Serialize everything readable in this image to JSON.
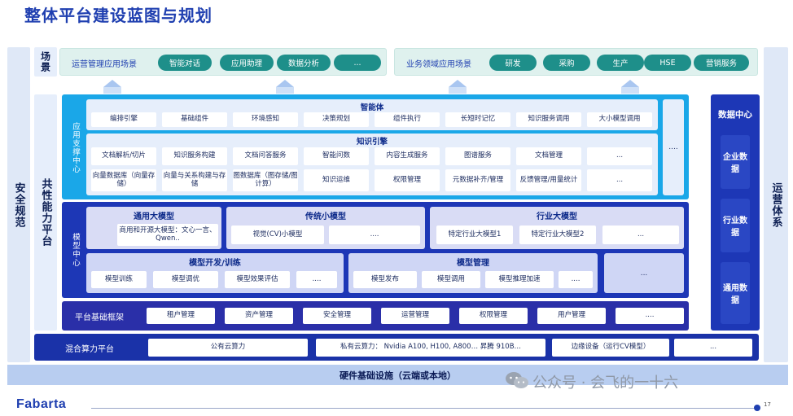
{
  "page_title": "整体平台建设蓝图与规划",
  "left_rail": "安全规范",
  "right_rail": "运营体系",
  "scenario": {
    "label": "场景",
    "ops_label": "运营管理应用场景",
    "ops_items": [
      "智能对话",
      "应用助理",
      "数据分析",
      "..."
    ],
    "biz_label": "业务领域应用场景",
    "biz_items": [
      "研发",
      "采购",
      "生产",
      "HSE",
      "营销服务"
    ]
  },
  "shared_platform_label": "共性能力平台",
  "app_center": {
    "label": "应用支撑中心",
    "agent": {
      "title": "智能体",
      "items": [
        "编排引擎",
        "基础组件",
        "环境感知",
        "决策规划",
        "组件执行",
        "长短时记忆",
        "知识服务调用",
        "大小模型调用"
      ]
    },
    "knowledge": {
      "title": "知识引擎",
      "row1": [
        "文档解析/切片",
        "知识服务构建",
        "文档问答服务",
        "智能问数",
        "内容生成服务",
        "图谱服务",
        "文档管理",
        "..."
      ],
      "row2": [
        "向量数据库（向量存储）",
        "向量与关系构建与存储",
        "图数据库（图存储/图计算）",
        "知识运维",
        "权限管理",
        "元数据补齐/管理",
        "反馈管理/用量统计",
        "..."
      ]
    },
    "more": "...."
  },
  "model_center": {
    "label": "模型中心",
    "general": {
      "title": "通用大模型",
      "items": [
        "商用和开源大模型：文心一言、Qwen.."
      ]
    },
    "traditional": {
      "title": "传统小模型",
      "items": [
        "视觉(CV)小模型",
        "...."
      ]
    },
    "industry": {
      "title": "行业大模型",
      "items": [
        "特定行业大模型1",
        "特定行业大模型2",
        "..."
      ]
    },
    "dev": {
      "title": "模型开发/训练",
      "items": [
        "模型训练",
        "模型调优",
        "模型效果评估",
        "...."
      ]
    },
    "mgmt": {
      "title": "模型管理",
      "items": [
        "模型发布",
        "模型调用",
        "模型推理加速",
        "...."
      ]
    },
    "more": "..."
  },
  "platform_base": {
    "label": "平台基础框架",
    "items": [
      "租户管理",
      "资产管理",
      "安全管理",
      "运营管理",
      "权限管理",
      "用户管理",
      "...."
    ]
  },
  "data_center": {
    "title": "数据中心",
    "items": [
      "企业数据",
      "行业数据",
      "通用数据"
    ]
  },
  "compute": {
    "label": "混合算力平台",
    "items": [
      "公有云算力",
      "私有云算力： Nvidia A100, H100, A800… 昇腾 910B…",
      "边缘设备（运行CV模型）",
      "..."
    ]
  },
  "hardware": "硬件基础设施（云端或本地）",
  "watermark": "公众号 · 会飞的一十六",
  "logo": "Fabarta",
  "page_number": "17",
  "colors": {
    "title": "#1f3fb0",
    "deep_blue": "#1d37b6",
    "cyan": "#1aa7e8",
    "teal_pill": "#1e8f8a",
    "scenario_bg": "#dff1ee",
    "rail_bg": "#dfe8f7"
  }
}
